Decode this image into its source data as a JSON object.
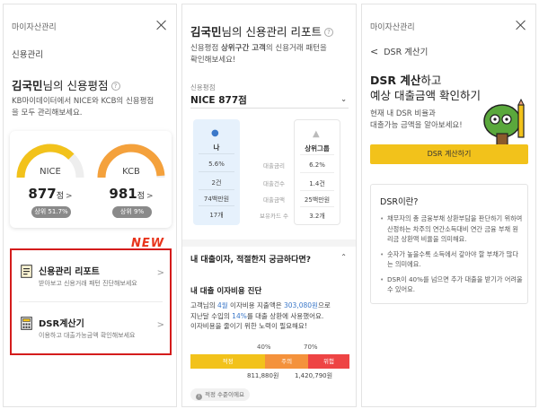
{
  "panel1": {
    "topbar_title": "마이자산관리",
    "subtitle": "신용관리",
    "heading_name": "김국민",
    "heading_suffix": "님의 신용평점",
    "description_line1": "KB마이데이터에서 NICE와 KCB의 신용평점",
    "description_line2": "을 모두 관리해보세요.",
    "gauges": [
      {
        "name": "NICE",
        "score": "877",
        "unit": "점",
        "rank": "상위 51.7%",
        "fill_fraction": 0.75,
        "color": "#f2c21b"
      },
      {
        "name": "KCB",
        "score": "981",
        "unit": "점",
        "rank": "상위 9%",
        "fill_fraction": 0.98,
        "color": "#f4a13c"
      }
    ],
    "new_tag": "NEW",
    "menu": [
      {
        "title": "신용관리 리포트",
        "desc": "받아보고 신용거래 패턴 진단해보세요"
      },
      {
        "title": "DSR계산기",
        "desc": "이용하고 대출가능금액 확인해보세요"
      }
    ]
  },
  "panel2": {
    "heading_name": "김국민",
    "heading_suffix": "님의 신용관리 리포트",
    "desc_prefix": "신용평점 ",
    "desc_bold": "상위구간 고객",
    "desc_suffix": "의 신용거래 패턴을",
    "desc_line2": "확인해보세요!",
    "field_label": "신용평점",
    "select_value": "NICE 877점",
    "compare": {
      "me_label": "나",
      "group_label": "상위그룹",
      "row_labels": [
        "대출금리",
        "대출건수",
        "대출금액",
        "보유카드 수"
      ],
      "me_values": [
        "5.6%",
        "2건",
        "74백만원",
        "17개"
      ],
      "group_values": [
        "6.2%",
        "1.4건",
        "25백만원",
        "3.2개"
      ]
    },
    "question": "내 대출이자, 적절한지 궁금하다면?",
    "section_title": "내 대출 이자비용 진단",
    "section_text": {
      "p1": "고객님의 ",
      "h1": "4월",
      "p2": " 이자비용 지출액은 ",
      "h2": "303,080원",
      "p3": "으로",
      "p4": "지난달 수입의 ",
      "h3": "14%",
      "p5": "를 대출 상환에 사용했어요.",
      "p6": "이자비용을 줄이기 위한 노력이 필요해요!"
    },
    "thresholds": [
      "40%",
      "70%"
    ],
    "bar_segments": [
      {
        "label": "적정",
        "color": "#f2c21b",
        "fraction": 0.47
      },
      {
        "label": "주의",
        "color": "#f4923c",
        "fraction": 0.27
      },
      {
        "label": "위험",
        "color": "#ee4444",
        "fraction": 0.26
      }
    ],
    "bar_values": [
      "811,880원",
      "1,420,790원"
    ],
    "note": "적정 수준이에요"
  },
  "panel3": {
    "topbar_title": "마이자산관리",
    "back_label": "DSR 계산기",
    "heading_bold": "DSR 계산",
    "heading_light": "하고",
    "heading_line2": "예상 대출금액 확인하기",
    "description_line1": "현재 내 DSR 비율과",
    "description_line2": "대출가능 금액을 알아보세요!",
    "cta_label": "DSR 계산하기",
    "info_title": "DSR이란?",
    "info_items": [
      "채무자의 총 금융부채 상환부담을 판단하기 위하여 산정하는 차주의 연간소득대비 연간 금융 부채 원리금 상환액 비율을 의미해요.",
      "숫자가 높을수록 소득에서 갚아야 할 부채가 많다는 의미에요.",
      "DSR이 40%를 넘으면 추가 대출을 받기가 어려울 수 있어요."
    ]
  }
}
